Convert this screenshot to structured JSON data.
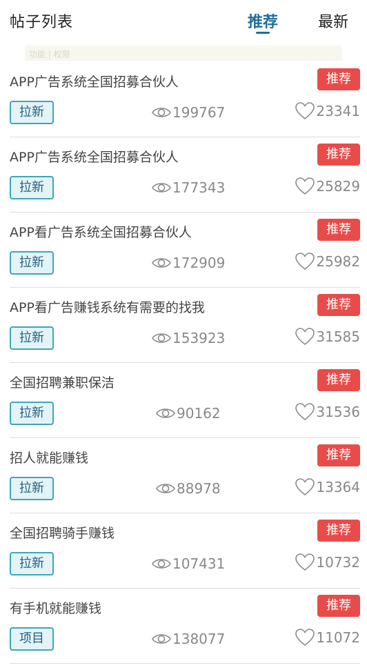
{
  "header": {
    "title": "帖子列表",
    "tabs": [
      {
        "label": "推荐",
        "active": true
      },
      {
        "label": "最新",
        "active": false
      }
    ]
  },
  "faded_banner": "功能 | 权限",
  "colors": {
    "accent": "#1f6e9c",
    "recommend_badge": "#e84c4a",
    "tag_border": "#3aa7b8",
    "tag_bg": "#e4f3f6"
  },
  "posts": [
    {
      "title": "APP广告系统全国招募合伙人",
      "badge": "推荐",
      "tag": "拉新",
      "views": "199767",
      "likes": "23341"
    },
    {
      "title": "APP广告系统全国招募合伙人",
      "badge": "推荐",
      "tag": "拉新",
      "views": "177343",
      "likes": "25829"
    },
    {
      "title": "APP看广告系统全国招募合伙人",
      "badge": "推荐",
      "tag": "拉新",
      "views": "172909",
      "likes": "25982"
    },
    {
      "title": "APP看广告赚钱系统有需要的找我",
      "badge": "推荐",
      "tag": "拉新",
      "views": "153923",
      "likes": "31585"
    },
    {
      "title": "全国招聘兼职保洁",
      "badge": "推荐",
      "tag": "拉新",
      "views": "90162",
      "likes": "31536"
    },
    {
      "title": "招人就能赚钱",
      "badge": "推荐",
      "tag": "拉新",
      "views": "88978",
      "likes": "13364"
    },
    {
      "title": "全国招聘骑手赚钱",
      "badge": "推荐",
      "tag": "拉新",
      "views": "107431",
      "likes": "10732"
    },
    {
      "title": "有手机就能赚钱",
      "badge": "推荐",
      "tag": "项目",
      "views": "138077",
      "likes": "11072"
    }
  ]
}
